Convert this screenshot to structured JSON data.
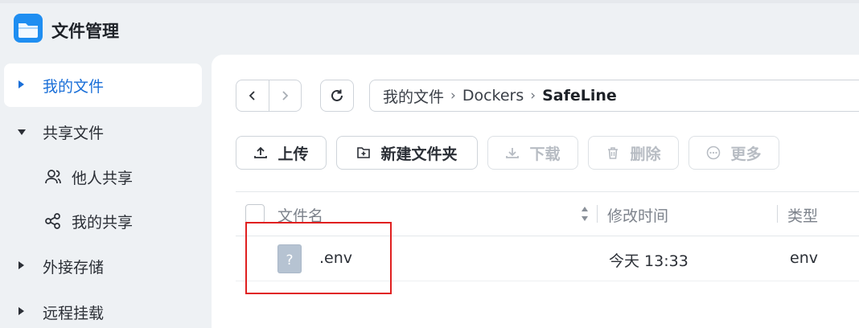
{
  "app": {
    "title": "文件管理",
    "logo_icon": "folder-app-icon"
  },
  "sidebar": {
    "items": [
      {
        "label": "我的文件",
        "active": true
      },
      {
        "label": "共享文件",
        "expanded": true
      },
      {
        "label": "他人共享",
        "icon": "people-icon"
      },
      {
        "label": "我的共享",
        "icon": "share-icon"
      },
      {
        "label": "外接存储"
      },
      {
        "label": "远程挂载"
      }
    ]
  },
  "breadcrumb": [
    "我的文件",
    "Dockers",
    "SafeLine"
  ],
  "toolbar": {
    "upload": "上传",
    "new_folder": "新建文件夹",
    "download": "下载",
    "delete": "删除",
    "more": "更多"
  },
  "table": {
    "columns": {
      "name": "文件名",
      "mtime": "修改时间",
      "type": "类型"
    },
    "rows": [
      {
        "name": ".env",
        "mtime": "今天 13:33",
        "type": "env",
        "icon": "unknown-file-icon"
      }
    ]
  },
  "colors": {
    "accent": "#1a6fd8",
    "highlight": "#e02020"
  }
}
